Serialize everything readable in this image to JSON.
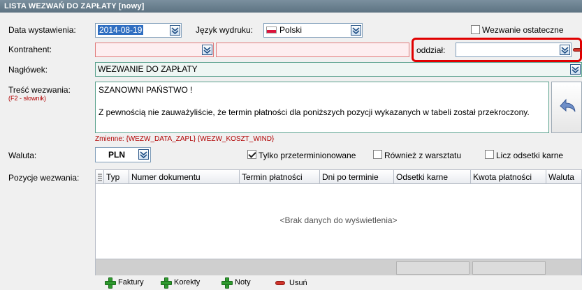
{
  "window": {
    "title": "LISTA WEZWAŃ DO ZAPŁATY [nowy]"
  },
  "form": {
    "issue_date_label": "Data wystawienia:",
    "issue_date_value": "2014-08-19",
    "print_lang_label": "Język wydruku:",
    "print_lang_value": "Polski",
    "final_notice_label": "Wezwanie ostateczne",
    "contractor_label": "Kontrahent:",
    "contractor_code": "",
    "contractor_name": "",
    "branch_label": "oddział:",
    "branch_value": "",
    "header_label": "Nagłówek:",
    "header_value": "WEZWANIE DO ZAPŁATY",
    "content_label": "Treść wezwania:",
    "content_hint": "(F2 - słownik)",
    "content_line1": "SZANOWNI PAŃSTWO !",
    "content_line2": "Z pewnością nie zauważyliście, że termin płatności dla poniższych pozycji wykazanych w tabeli został przekroczony.",
    "variables_text": "Zmienne: {WEZW_DATA_ZAPL} {WEZW_KOSZT_WIND}",
    "currency_label": "Waluta:",
    "currency_value": "PLN",
    "overdue_only_label": "Tylko przeterminionowane",
    "overdue_only_checked": true,
    "also_workshop_label": "Również z warsztatu",
    "calc_interest_label": "Licz odsetki karne"
  },
  "grid": {
    "label": "Pozycje wezwania:",
    "columns": [
      "Typ",
      "Numer dokumentu",
      "Termin płatności",
      "Dni po terminie",
      "Odsetki karne",
      "Kwota płatności",
      "Waluta"
    ],
    "empty_text": "<Brak danych do wyświetlenia>"
  },
  "toolbar": {
    "invoices": "Faktury",
    "corrections": "Korekty",
    "notes": "Noty",
    "remove": "Usuń"
  },
  "colors": {
    "title_bar": "#5d7382",
    "required_field": "#fdeef0",
    "highlight_border": "#e00000",
    "hint_text": "#b00000"
  }
}
